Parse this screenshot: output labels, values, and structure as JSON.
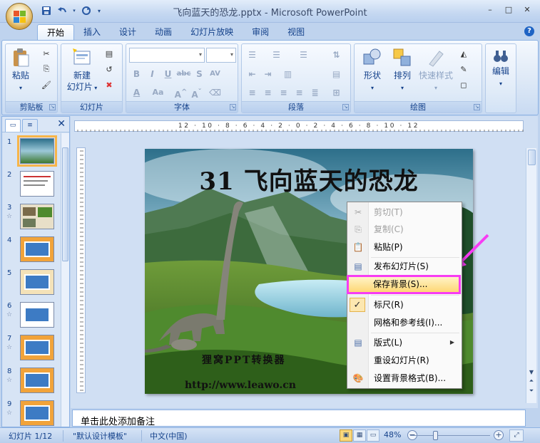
{
  "window": {
    "title": "飞向蓝天的恐龙.pptx - Microsoft PowerPoint",
    "controls": [
      "–",
      "□",
      "✕"
    ]
  },
  "qat": {
    "icons": [
      "save-icon",
      "undo-icon",
      "redo-icon",
      "customize-icon"
    ]
  },
  "tabs": [
    {
      "label": "开始",
      "active": true
    },
    {
      "label": "插入"
    },
    {
      "label": "设计"
    },
    {
      "label": "动画"
    },
    {
      "label": "幻灯片放映"
    },
    {
      "label": "审阅"
    },
    {
      "label": "视图"
    }
  ],
  "ribbon": {
    "clipboard": {
      "label": "剪贴板",
      "paste": "粘贴"
    },
    "slides": {
      "label": "幻灯片",
      "new_slide_1": "新建",
      "new_slide_2": "幻灯片"
    },
    "font": {
      "label": "字体"
    },
    "paragraph": {
      "label": "段落"
    },
    "drawing": {
      "label": "绘图",
      "shapes": "形状",
      "arrange": "排列",
      "quick_styles": "快速样式"
    },
    "editing": {
      "label": "编辑"
    }
  },
  "rulers": {
    "horizontal": "12 · 10 · 8 · 6 · 4 · 2 · 0 · 2 · 4 · 6 · 8 · 10 · 12"
  },
  "slides_panel": {
    "selected": 1,
    "items": [
      {
        "num": "1",
        "star": false
      },
      {
        "num": "2",
        "star": false
      },
      {
        "num": "3",
        "star": true
      },
      {
        "num": "4",
        "star": false
      },
      {
        "num": "5",
        "star": false
      },
      {
        "num": "6",
        "star": true
      },
      {
        "num": "7",
        "star": true
      },
      {
        "num": "8",
        "star": true
      },
      {
        "num": "9",
        "star": true
      }
    ]
  },
  "slide": {
    "title": "31  飞向蓝天的恐龙",
    "watermark_line1": "狸窝PPT转换器",
    "watermark_line2": "http://www.leawo.cn"
  },
  "context_menu": {
    "items": [
      {
        "label": "剪切(T)",
        "icon": "scissors-icon",
        "disabled": true
      },
      {
        "label": "复制(C)",
        "icon": "copy-icon",
        "disabled": true
      },
      {
        "label": "粘贴(P)",
        "icon": "paste-icon",
        "disabled": false
      },
      {
        "label": "发布幻灯片(S)",
        "icon": "publish-slides-icon",
        "disabled": false
      },
      {
        "label": "保存背景(S)...",
        "icon": "",
        "highlighted": true
      },
      {
        "label": "标尺(R)",
        "icon": "checkmark-icon",
        "checked": true
      },
      {
        "label": "网格和参考线(I)...",
        "icon": ""
      },
      {
        "label": "版式(L)",
        "icon": "layout-icon",
        "submenu": true
      },
      {
        "label": "重设幻灯片(R)",
        "icon": ""
      },
      {
        "label": "设置背景格式(B)...",
        "icon": "format-background-icon"
      }
    ],
    "highlight_color": "#f73cf3"
  },
  "notes": {
    "placeholder": "单击此处添加备注"
  },
  "status": {
    "slide_info": "幻灯片 1/12",
    "theme": "\"默认设计模板\"",
    "language": "中文(中国)",
    "zoom": "48%"
  }
}
